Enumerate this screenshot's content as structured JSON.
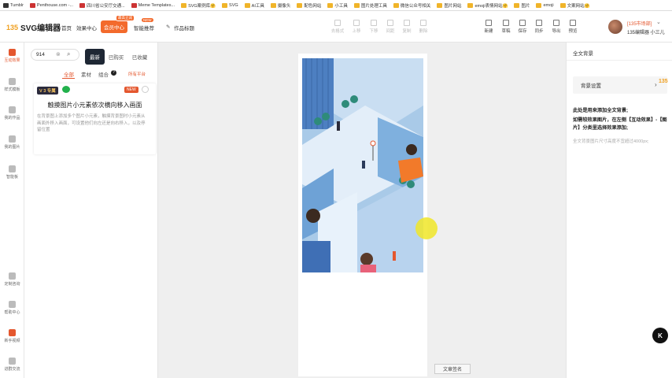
{
  "bookmarks": [
    {
      "label": "Tumblr",
      "icon": "tumblr-icon"
    },
    {
      "label": "Penthouse.com -...",
      "icon": "site-icon"
    },
    {
      "label": "四川省公安厅交通...",
      "icon": "site-icon"
    },
    {
      "label": "Meme Templates...",
      "icon": "site-icon"
    },
    {
      "label": "SVG案例库🤗",
      "icon": "folder-icon"
    },
    {
      "label": "SVG",
      "icon": "folder-icon"
    },
    {
      "label": "AI工具",
      "icon": "folder-icon"
    },
    {
      "label": "摄像头",
      "icon": "folder-icon"
    },
    {
      "label": "配色网站",
      "icon": "folder-icon"
    },
    {
      "label": "小工具",
      "icon": "folder-icon"
    },
    {
      "label": "图片处理工具",
      "icon": "folder-icon"
    },
    {
      "label": "微信公众号相关",
      "icon": "folder-icon"
    },
    {
      "label": "图片网站",
      "icon": "folder-icon"
    },
    {
      "label": "emoji表情网站🤗",
      "icon": "folder-icon"
    },
    {
      "label": "图片",
      "icon": "folder-icon"
    },
    {
      "label": "emoji",
      "icon": "folder-icon"
    },
    {
      "label": "文案网站🤗",
      "icon": "folder-icon"
    }
  ],
  "header": {
    "logo_mark": "135",
    "logo_text": "SVG编辑器",
    "nav": [
      "首页",
      "效果中心"
    ],
    "vip_label": "会员中心",
    "vip_badge": "最高立减",
    "smart_label": "智能推荐",
    "new_badge": "NEW",
    "doc_title": "作品标题",
    "edit_tools": [
      "去格式",
      "上移",
      "下移",
      "间距",
      "复制",
      "删除"
    ],
    "main_tools": [
      "新建",
      "草稿",
      "保存",
      "同步",
      "导出",
      "预览"
    ],
    "user_vip": "[135市场部]",
    "user_name": "135编辑器 小三儿"
  },
  "rail": [
    "互动效果",
    "样式模板",
    "我的作品",
    "我的图片",
    "智能板",
    "定制咨询",
    "帮助中心",
    "新手视频",
    "进群交流"
  ],
  "panel": {
    "search_value": "914",
    "tabs": [
      "最新",
      "已购买",
      "已收藏"
    ],
    "filters": [
      "全部",
      "素材",
      "组合"
    ],
    "all_platforms": "所有平台",
    "card": {
      "tag": "V 3 专属",
      "new": "NEW",
      "title": "触摸图片小元素依次横向移入画面",
      "desc": "在背景图上添加多个图片小元素，触摸背景图时小元素从画面外移入画面，可设置他们向左还是向右移入，以及停留位置"
    }
  },
  "canvas": {
    "full_title": "文章签名"
  },
  "right": {
    "title": "全文背景",
    "bg_setting": "背景设置",
    "logo": "135",
    "line1": "此处是用来添加全文背景;",
    "line2": "如需较效果图片，在左侧【互动效果】-【图片】分类里选择效果添加;",
    "hint": "全文背景图片尺寸高度不宜超过4000px;"
  },
  "colors": {
    "accent": "#e4572e",
    "dark_tab": "#1e2734",
    "brand": "#f0a020"
  }
}
